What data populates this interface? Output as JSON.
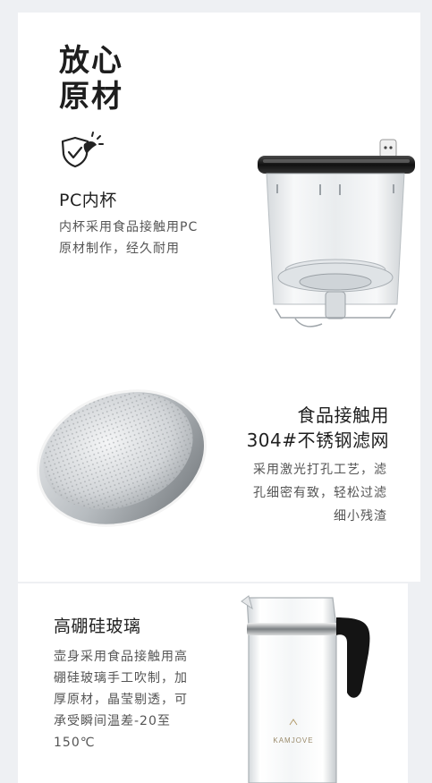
{
  "hero": {
    "title_line1": "放心",
    "title_line2": "原材",
    "icon": "shield-leaf-icon"
  },
  "inner_cup": {
    "title": "PC内杯",
    "desc_line1": "内杯采用食品接触用PC",
    "desc_line2": "原材制作，经久耐用",
    "image": "pc-inner-cup-image"
  },
  "filter": {
    "title_line1": "食品接触用",
    "title_line2": "304#不锈钢滤网",
    "desc_line1": "采用激光打孔工艺，滤",
    "desc_line2": "孔细密有致，轻松过滤",
    "desc_line3": "细小残渣",
    "image": "stainless-filter-image"
  },
  "glass": {
    "title": "高硼硅玻璃",
    "desc_line1": "壶身采用食品接触用高",
    "desc_line2": "硼硅玻璃手工吹制，加",
    "desc_line3": "厚原材，晶莹剔透，可",
    "desc_line4": "承受瞬间温差-20至",
    "desc_line5": "150℃",
    "brand_mark": "KAMJOVE",
    "image": "glass-pitcher-image"
  },
  "colors": {
    "page_bg": "#eef0f3",
    "card_bg": "#ffffff",
    "text_dark": "#1e1e1e",
    "text_body": "#555555",
    "accent_red": "#e0292a"
  }
}
